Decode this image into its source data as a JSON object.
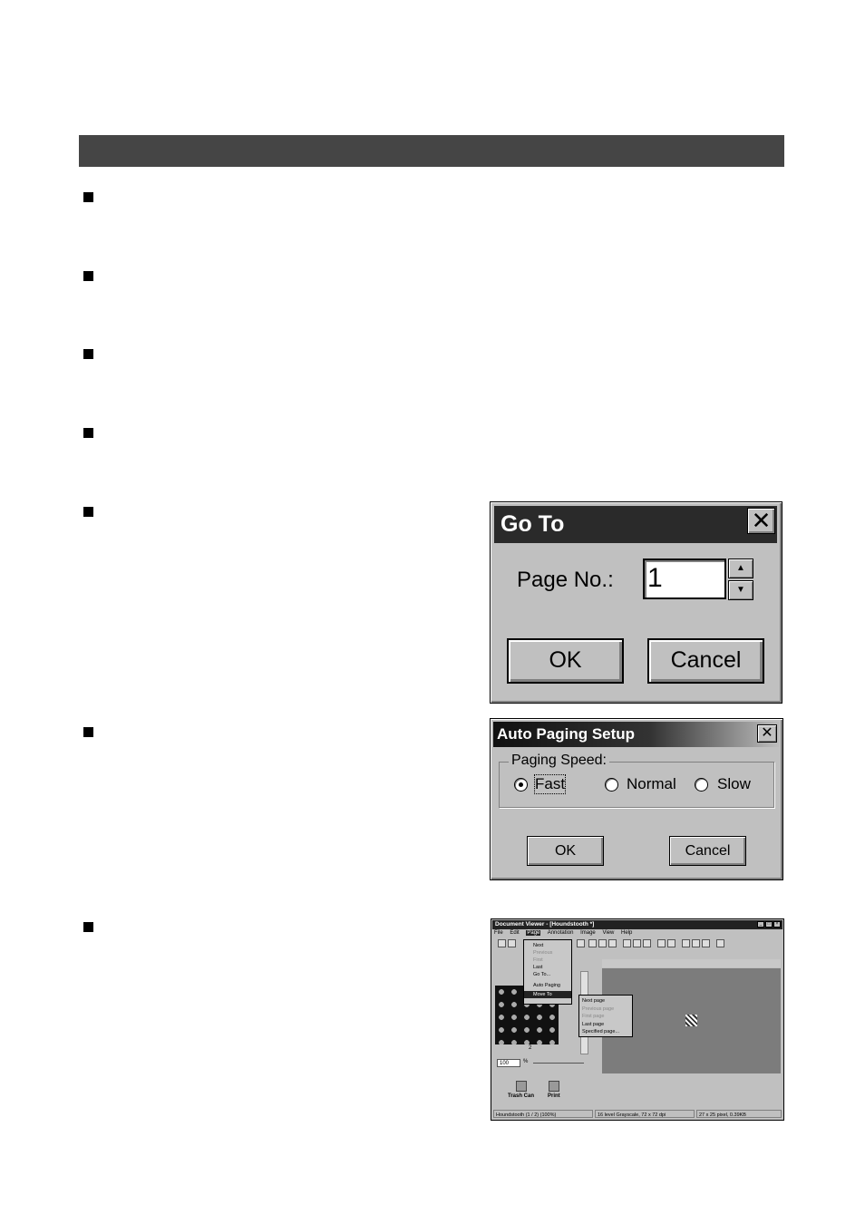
{
  "goto_dialog": {
    "title": "Go To",
    "close": "✕",
    "page_label": "Page No.:",
    "page_value": "1",
    "ok": "OK",
    "cancel": "Cancel"
  },
  "auto_paging_dialog": {
    "title": "Auto Paging Setup",
    "close": "✕",
    "group_label": "Paging Speed:",
    "options": [
      "Fast",
      "Normal",
      "Slow"
    ],
    "selected": "Fast",
    "ok": "OK",
    "cancel": "Cancel"
  },
  "document_viewer": {
    "title": "Document Viewer - [Houndstooth *]",
    "menubar": [
      "File",
      "Edit",
      "Page",
      "Annotation",
      "Image",
      "View",
      "Help"
    ],
    "page_menu": [
      "Next",
      "Previous",
      "First",
      "Last",
      "Go To...",
      "Auto Paging",
      "Move To"
    ],
    "move_to_submenu": [
      "Next page",
      "Previous page",
      "First page",
      "Last page",
      "Specified page..."
    ],
    "thumbnail_number": "2",
    "zoom_value": "100",
    "zoom_unit": "%",
    "trash_label": "Trash Can",
    "print_label": "Print",
    "status": [
      "Houndstooth (1 / 2) (100%)",
      "16 level Grayscale, 72 x 72 dpi",
      "27 x 25 pixel, 0.39KB"
    ]
  }
}
